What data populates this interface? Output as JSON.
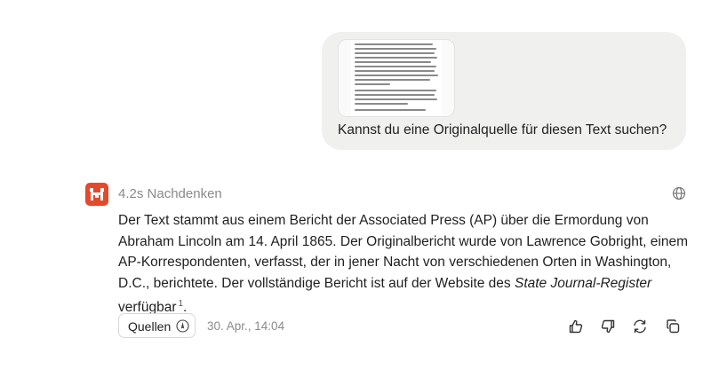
{
  "user_message": {
    "text": "Kannst du eine Originalquelle für diesen Text suchen?"
  },
  "assistant": {
    "status": "4.2s Nachdenken",
    "answer_part1": "Der Text stammt aus einem Bericht der Associated Press (AP) über die Ermordung von Abraham Lincoln am 14. April 1865. Der Originalbericht wurde von Lawrence Gobright, einem AP-Korrespondenten, verfasst, der in jener Nacht von verschiedenen Orten in Washington, D.C., berichtete. Der vollständige Bericht ist auf der Website des ",
    "answer_italic": "State Journal-Register",
    "answer_part2": " verfügbar",
    "citation": "1",
    "answer_end": ".",
    "sources_label": "Quellen",
    "timestamp": "30. Apr., 14:04"
  },
  "icons": {
    "logo": "logo-icon",
    "globe": "globe-icon",
    "sources": "compass-icon",
    "like": "thumbs-up-icon",
    "dislike": "thumbs-down-icon",
    "regenerate": "refresh-icon",
    "copy": "copy-icon"
  },
  "colors": {
    "brand": "#e24a2b",
    "bubble": "#f0f0ef",
    "muted": "#8a8a8a"
  }
}
